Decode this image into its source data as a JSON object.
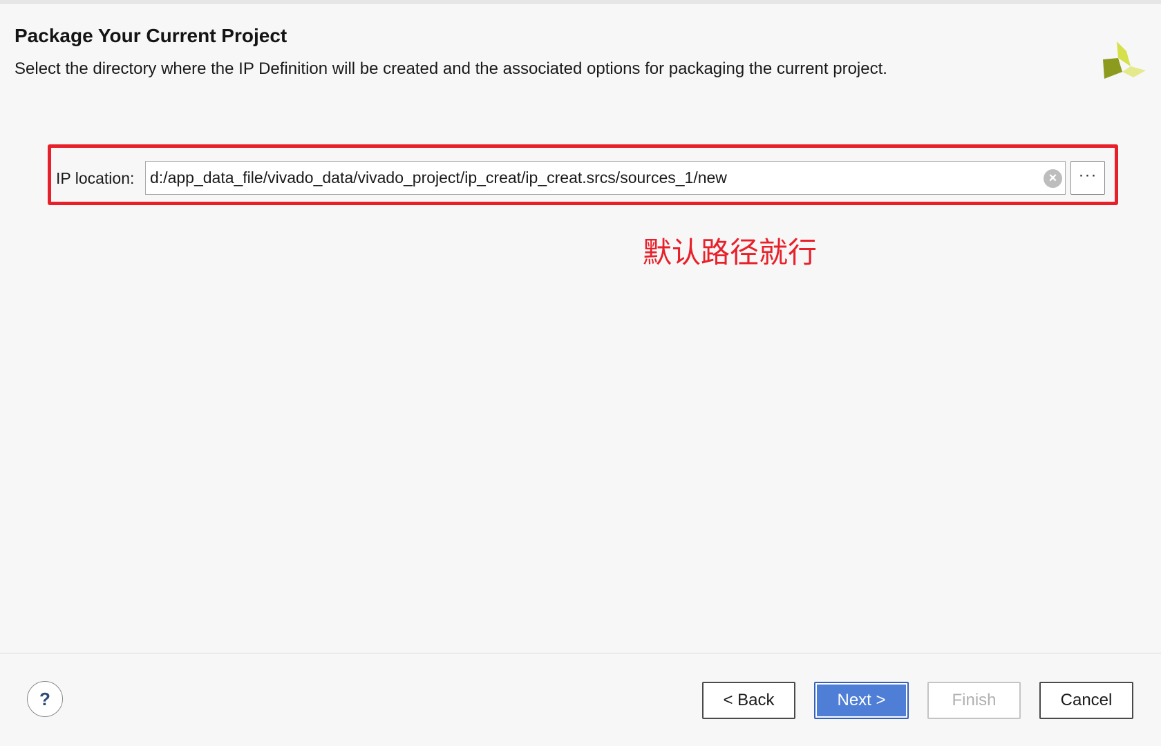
{
  "header": {
    "title": "Package Your Current Project",
    "description": "Select the directory where the IP Definition will be created and the associated options for packaging the current project.",
    "logo_icon": "xilinx-logo-icon"
  },
  "form": {
    "ip_location_label": "IP location:",
    "ip_location_value": "d:/app_data_file/vivado_data/vivado_project/ip_creat/ip_creat.srcs/sources_1/new",
    "clear_icon": "clear-icon",
    "browse_label": "···"
  },
  "annotation": {
    "note": "默认路径就行",
    "color": "#e8202a"
  },
  "footer": {
    "help_label": "?",
    "back_label": "< Back",
    "next_label": "Next >",
    "finish_label": "Finish",
    "cancel_label": "Cancel"
  },
  "colors": {
    "accent": "#4e7ed6",
    "background": "#f7f7f7"
  }
}
